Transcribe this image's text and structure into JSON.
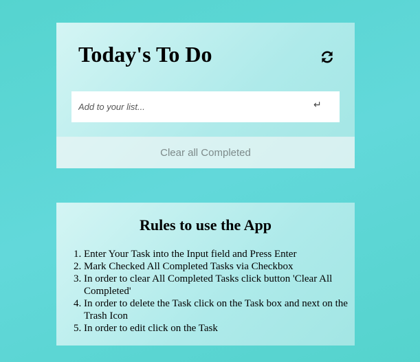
{
  "todo": {
    "title": "Today's To Do",
    "refresh_icon": "refresh-icon",
    "input_placeholder": "Add to your list...",
    "input_value": "",
    "enter_icon": "↵",
    "clear_label": "Clear all Completed"
  },
  "rules": {
    "title": "Rules to use the App",
    "items": [
      "Enter Your Task into the Input field and Press Enter",
      "Mark Checked All Completed Tasks via Checkbox",
      "In order to clear All Completed Tasks click button 'Clear All Completed'",
      "In order to delete the Task click on the Task box and next on the Trash Icon",
      "In order to edit click on the Task"
    ]
  },
  "colors": {
    "background": "#5fd6d6",
    "card": "#c5f1f0",
    "clear_text": "#7d8a8a"
  }
}
